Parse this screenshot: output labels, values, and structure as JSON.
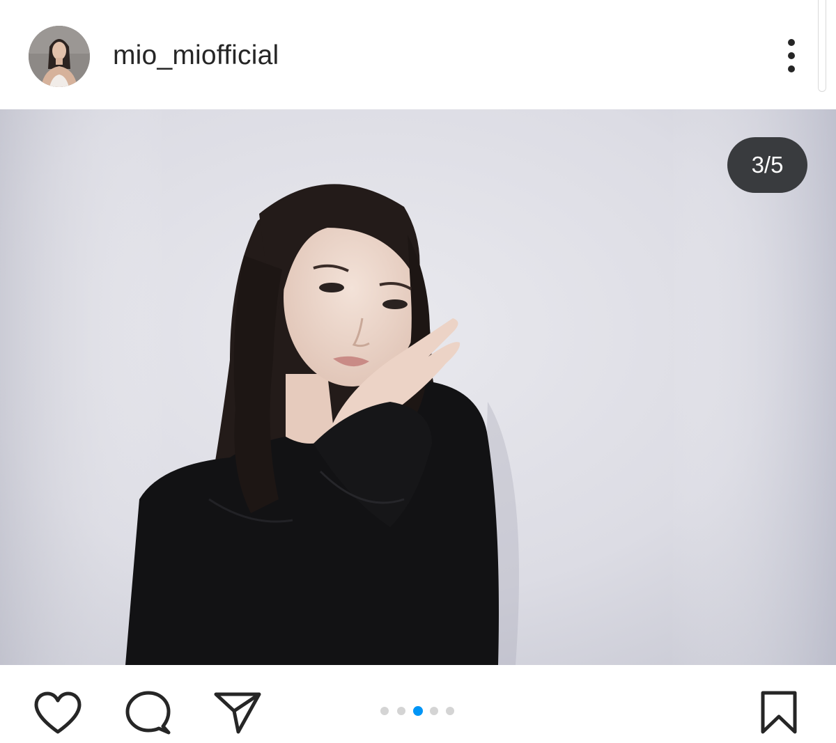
{
  "post": {
    "username": "mio_miofficial",
    "image_counter": "3/5",
    "carousel": {
      "total": 5,
      "active_index": 2,
      "active_color": "#0095f6",
      "inactive_color": "#d4d4d4"
    }
  },
  "icons": {
    "avatar": "profile-photo",
    "more": "three-dots-vertical-icon",
    "like": "heart-icon",
    "comment": "speech-bubble-icon",
    "share": "paper-plane-icon",
    "save": "bookmark-icon"
  },
  "colors": {
    "text": "#262626",
    "badge_bg": "#393b3e",
    "background": "#ffffff"
  }
}
